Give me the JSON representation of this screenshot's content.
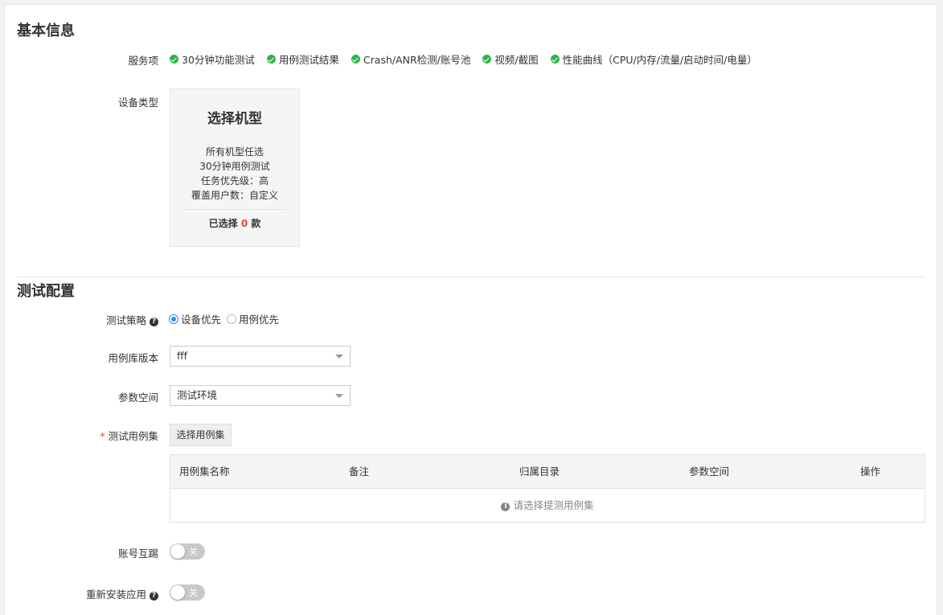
{
  "basic": {
    "title": "基本信息",
    "service_label": "服务项",
    "services": [
      "30分钟功能测试",
      "用例测试结果",
      "Crash/ANR检测/账号池",
      "视频/截图",
      "性能曲线（CPU/内存/流量/启动时间/电量）"
    ],
    "device_type_label": "设备类型",
    "device_card": {
      "title": "选择机型",
      "lines": [
        "所有机型任选",
        "30分钟用例测试",
        "任务优先级：高",
        "覆盖用户数：自定义"
      ],
      "selected_prefix": "已选择",
      "selected_count": "0",
      "selected_suffix": "款"
    }
  },
  "config": {
    "title": "测试配置",
    "strategy_label": "测试策略",
    "strategy_options": [
      "设备优先",
      "用例优先"
    ],
    "strategy_selected": "设备优先",
    "lib_version_label": "用例库版本",
    "lib_version_value": "fff",
    "param_space_label": "参数空间",
    "param_space_value": "测试环境",
    "case_set_label": "测试用例集",
    "required_mark": "*",
    "select_case_button": "选择用例集",
    "table": {
      "headers": [
        "用例集名称",
        "备注",
        "归属目录",
        "参数空间",
        "操作"
      ],
      "empty_text": "请选择提测用例集"
    },
    "account_kick_label": "账号互踢",
    "account_kick_state": "关",
    "reinstall_label": "重新安装应用",
    "reinstall_state": "关"
  },
  "icons": {
    "check": "check-circle-icon",
    "help": "question-circle-icon",
    "info": "info-circle-icon"
  },
  "colors": {
    "check_green": "#2cb54a",
    "radio_blue": "#2b8ef0",
    "count_red": "#e43"
  }
}
